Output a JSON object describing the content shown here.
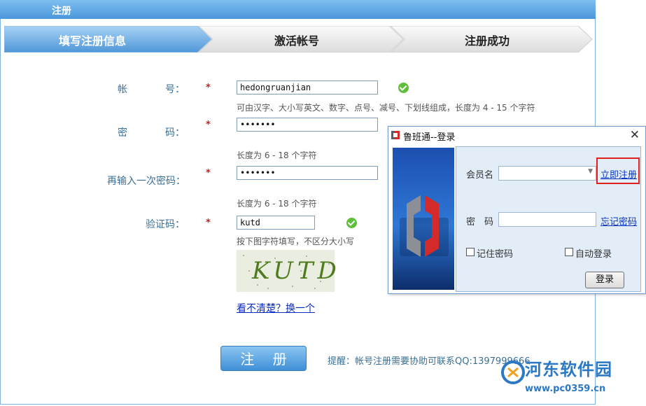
{
  "window": {
    "title": "注册"
  },
  "steps": [
    {
      "label": "填写注册信息",
      "active": true
    },
    {
      "label": "激活帐号",
      "active": false
    },
    {
      "label": "注册成功",
      "active": false
    }
  ],
  "form": {
    "required_mark": "*",
    "account": {
      "label_a": "帐",
      "label_b": "号：",
      "value": "hedongruanjian",
      "hint": "可由汉字、大小写英文、数字、点号、减号、下划线组成，长度为 4 - 15 个字符"
    },
    "password": {
      "label_a": "密",
      "label_b": "码：",
      "value": "•••••••",
      "hint": "长度为 6 - 18 个字符"
    },
    "confirm_password": {
      "label": "再输入一次密码：",
      "value": "•••••••",
      "hint": "长度为 6 - 18 个字符"
    },
    "captcha": {
      "label": "验证码：",
      "value": "kutd",
      "hint": "按下图字符填写，不区分大小写",
      "image_text": "KUTD",
      "refresh_link": "看不清楚？换一个"
    }
  },
  "register_button": "注 册",
  "reminder": "提醒：帐号注册需要协助可联系QQ:1397999666",
  "login_dialog": {
    "title": "鲁班通--登录",
    "close": "✕",
    "member_label": "会员名",
    "member_value": "",
    "register_now": "立即注册",
    "password_label": "密　码",
    "password_value": "",
    "forgot_password": "忘记密码",
    "remember_password": "记住密码",
    "auto_login": "自动登录",
    "login_button": "登录"
  },
  "watermark": {
    "name": "河东软件园",
    "url": "www.pc0359.cn"
  },
  "colors": {
    "accent": "#4a97dc",
    "highlight": "#e32020",
    "label": "#3a6f96",
    "check": "#5fbf3a"
  }
}
